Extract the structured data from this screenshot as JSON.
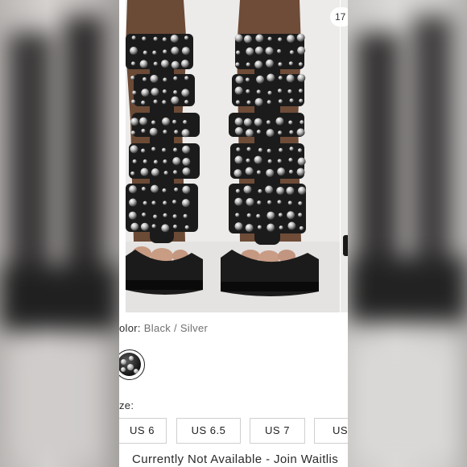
{
  "carousel": {
    "count_badge": "17"
  },
  "product": {
    "color_label": "olor:",
    "color_value": "Black / Silver",
    "size_label": "ze:",
    "sizes": [
      "US 6",
      "US 6.5",
      "US 7",
      "US"
    ],
    "availability": "Currently Not Available - Join Waitlis"
  },
  "colors": {
    "strap": "#1b1b1b",
    "stud_silver": "#c8c8c8",
    "background_photo": "#ececea",
    "border": "#cfcfcf"
  }
}
